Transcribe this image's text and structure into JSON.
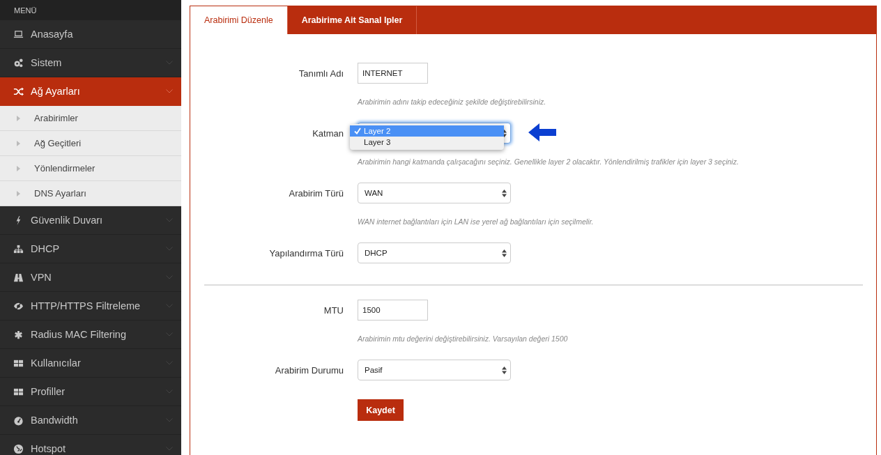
{
  "sidebar": {
    "header": "MENÜ",
    "items": [
      {
        "label": "Anasayfa",
        "selected": false,
        "expandable": false
      },
      {
        "label": "Sistem",
        "selected": false,
        "expandable": true
      },
      {
        "label": "Ağ Ayarları",
        "selected": true,
        "expandable": true,
        "children": [
          {
            "label": "Arabirimler"
          },
          {
            "label": "Ağ Geçitleri"
          },
          {
            "label": "Yönlendirmeler"
          },
          {
            "label": "DNS Ayarları"
          }
        ]
      },
      {
        "label": "Güvenlik Duvarı",
        "selected": false,
        "expandable": true
      },
      {
        "label": "DHCP",
        "selected": false,
        "expandable": true
      },
      {
        "label": "VPN",
        "selected": false,
        "expandable": true
      },
      {
        "label": "HTTP/HTTPS Filtreleme",
        "selected": false,
        "expandable": true
      },
      {
        "label": "Radius MAC Filtering",
        "selected": false,
        "expandable": true
      },
      {
        "label": "Kullanıcılar",
        "selected": false,
        "expandable": true
      },
      {
        "label": "Profiller",
        "selected": false,
        "expandable": true
      },
      {
        "label": "Bandwidth",
        "selected": false,
        "expandable": true
      },
      {
        "label": "Hotspot",
        "selected": false,
        "expandable": true
      }
    ]
  },
  "tabs": [
    {
      "label": "Arabirimi Düzenle",
      "selected": true
    },
    {
      "label": "Arabirime Ait Sanal Ipler",
      "selected": false
    }
  ],
  "sections": [
    [
      {
        "kind": "text",
        "label": "Tanımlı Adı",
        "value": "INTERNET",
        "help": "Arabirimin adını takip edeceğiniz şekilde değiştirebilirsiniz."
      },
      {
        "kind": "select",
        "label": "Katman",
        "open": true,
        "options": [
          {
            "label": "Layer 2",
            "selected": true
          },
          {
            "label": "Layer 3",
            "selected": false
          }
        ],
        "help": "Arabirimin hangi katmanda çalışacağını seçiniz. Genellikle layer 2 olacaktır. Yönlendirilmiş trafikler için layer 3 seçiniz."
      },
      {
        "kind": "select",
        "label": "Arabirim Türü",
        "value": "WAN",
        "help": "WAN internet bağlantıları için LAN ise yerel ağ bağlantıları için seçilmelir."
      },
      {
        "kind": "select",
        "label": "Yapılandırma Türü",
        "value": "DHCP"
      }
    ],
    [
      {
        "kind": "text",
        "label": "MTU",
        "value": "1500",
        "help": "Arabirimin mtu değerini değiştirebilirsiniz. Varsayılan değeri 1500"
      },
      {
        "kind": "select",
        "label": "Arabirim Durumu",
        "value": "Pasif"
      }
    ]
  ],
  "save_button": "Kaydet"
}
